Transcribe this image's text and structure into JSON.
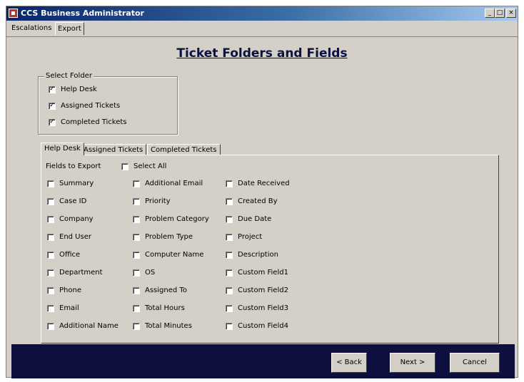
{
  "window": {
    "title": "CCS Business Administrator",
    "controls": {
      "minimize": "_",
      "maximize": "□",
      "close": "×"
    }
  },
  "menu": {
    "tabs": [
      "Escalations",
      "Export"
    ],
    "active": "Export"
  },
  "page": {
    "title": "Ticket Folders and  Fields"
  },
  "select_folder": {
    "legend": "Select Folder",
    "items": [
      {
        "label": "Help Desk",
        "checked": true
      },
      {
        "label": "Assigned Tickets",
        "checked": true
      },
      {
        "label": "Completed Tickets",
        "checked": true
      }
    ]
  },
  "tabs": {
    "items": [
      "Help Desk",
      "Assigned Tickets",
      "Completed Tickets"
    ],
    "active": "Help Desk"
  },
  "fields": {
    "header": "Fields to Export",
    "select_all": {
      "label": "Select All",
      "checked": false
    },
    "columns": [
      [
        "Summary",
        "Case ID",
        "Company",
        "End User",
        "Office",
        "Department",
        "Phone",
        "Email",
        "Additional Name"
      ],
      [
        "Additional Email",
        "Priority",
        "Problem Category",
        "Problem Type",
        "Computer Name",
        "OS",
        "Assigned To",
        "Total Hours",
        "Total Minutes"
      ],
      [
        "Date Received",
        "Created By",
        "Due Date",
        "Project",
        "Description",
        "Custom Field1",
        "Custom Field2",
        "Custom Field3",
        "Custom Field4"
      ]
    ]
  },
  "buttons": {
    "back": "< Back",
    "next": "Next >",
    "cancel": "Cancel"
  },
  "colors": {
    "title_bar": "#0a246a",
    "footer": "#0d0f3e",
    "face": "#d4d0c8"
  }
}
